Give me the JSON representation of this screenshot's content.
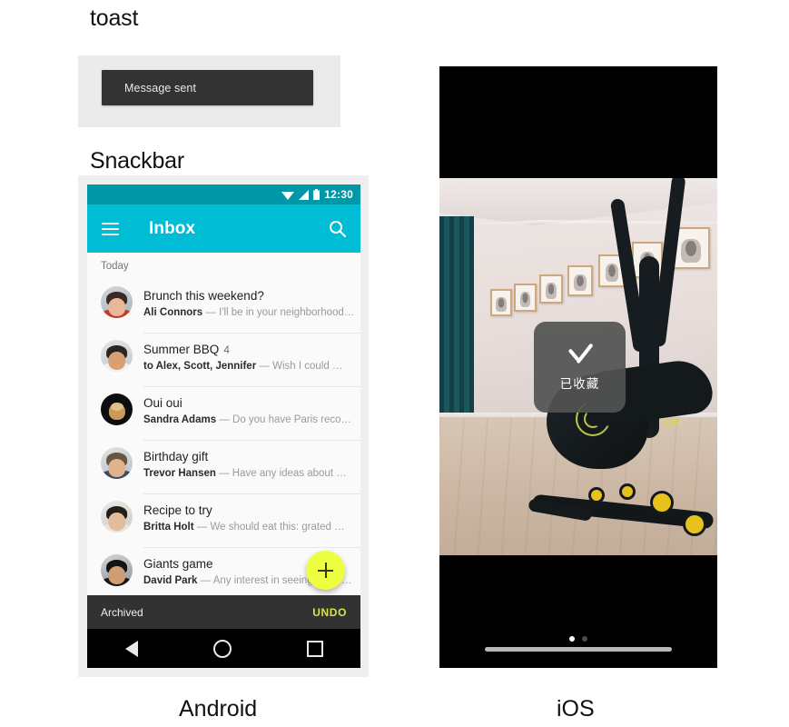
{
  "sections": {
    "toast_heading": "toast",
    "snackbar_heading": "Snackbar"
  },
  "toast_demo": {
    "message": "Message sent",
    "bubble_color": "#333333",
    "panel_color": "#ebebeb"
  },
  "android": {
    "caption": "Android",
    "status_bar": {
      "time": "12:30",
      "icons": [
        "wifi-icon",
        "signal-icon",
        "battery-icon"
      ],
      "color": "#0097a7"
    },
    "app_bar": {
      "menu_icon": "hamburger-menu-icon",
      "title": "Inbox",
      "search_icon": "search-icon",
      "color": "#00bcd4"
    },
    "list_header": "Today",
    "messages": [
      {
        "subject": "Brunch this weekend?",
        "count": "",
        "sender": "Ali Connors",
        "snippet": "— I'll be in your neighborhood…",
        "avatar": "avatar-ali-connors"
      },
      {
        "subject": "Summer BBQ",
        "count": "4",
        "sender": "to Alex, Scott, Jennifer",
        "snippet": "— Wish I could …",
        "avatar": "avatar-summer-bbq"
      },
      {
        "subject": "Oui oui",
        "count": "",
        "sender": "Sandra Adams",
        "snippet": "— Do you have Paris reco…",
        "avatar": "avatar-sandra-adams"
      },
      {
        "subject": "Birthday gift",
        "count": "",
        "sender": "Trevor Hansen",
        "snippet": "— Have any ideas about …",
        "avatar": "avatar-trevor-hansen"
      },
      {
        "subject": "Recipe to try",
        "count": "",
        "sender": "Britta Holt",
        "snippet": "— We should eat this: grated …",
        "avatar": "avatar-britta-holt"
      },
      {
        "subject": "Giants game",
        "count": "",
        "sender": "David Park",
        "snippet": "— Any interest in seeing the G…",
        "avatar": "avatar-david-park"
      }
    ],
    "fab": {
      "icon": "plus-icon",
      "color": "#eeff41"
    },
    "snackbar": {
      "message": "Archived",
      "action_label": "UNDO",
      "background": "#323232",
      "action_color": "#d7e445"
    },
    "nav_bar": {
      "back_icon": "back-triangle-icon",
      "home_icon": "home-circle-icon",
      "recents_icon": "recents-square-icon"
    }
  },
  "ios": {
    "caption": "iOS",
    "photo_description": "room-with-elliptical-machine-photo",
    "hud_toast": {
      "icon": "checkmark-icon",
      "label": "已收藏",
      "background": "rgba(82,82,82,0.92)"
    },
    "page_dots": {
      "total": 2,
      "active_index": 0
    },
    "home_indicator": "home-indicator-bar"
  }
}
